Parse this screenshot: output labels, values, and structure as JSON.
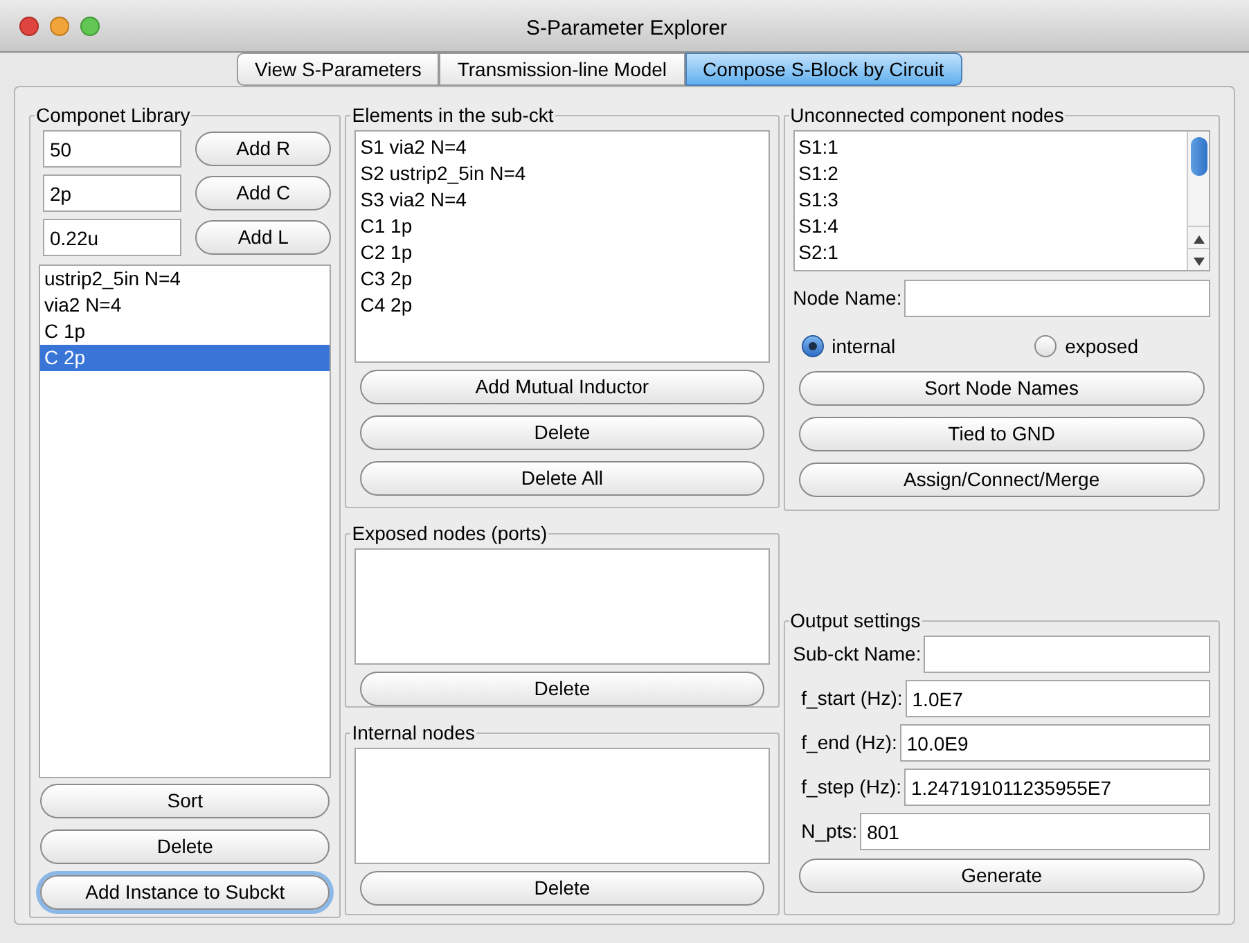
{
  "window": {
    "title": "S-Parameter Explorer"
  },
  "tabs": [
    {
      "label": "View S-Parameters",
      "selected": false
    },
    {
      "label": "Transmission-line Model",
      "selected": false
    },
    {
      "label": "Compose S-Block by Circuit",
      "selected": true
    }
  ],
  "library": {
    "title": "Componet Library",
    "inputs": [
      {
        "value": "50",
        "button": "Add R"
      },
      {
        "value": "2p",
        "button": "Add C"
      },
      {
        "value": "0.22u",
        "button": "Add L"
      }
    ],
    "items": [
      {
        "label": "ustrip2_5in N=4",
        "selected": false
      },
      {
        "label": "via2 N=4",
        "selected": false
      },
      {
        "label": "C 1p",
        "selected": false
      },
      {
        "label": "C 2p",
        "selected": true
      }
    ],
    "buttons": [
      {
        "label": "Sort",
        "focused": false
      },
      {
        "label": "Delete",
        "focused": false
      },
      {
        "label": "Add Instance to Subckt",
        "focused": true
      }
    ]
  },
  "elements": {
    "title": "Elements in the sub-ckt",
    "items": [
      "S1 via2 N=4",
      "S2 ustrip2_5in N=4",
      "S3 via2 N=4",
      "C1 1p",
      "C2 1p",
      "C3 2p",
      "C4 2p"
    ],
    "buttons": [
      "Add Mutual Inductor",
      "Delete",
      "Delete All"
    ]
  },
  "exposed": {
    "title": "Exposed nodes (ports)",
    "buttons": [
      "Delete"
    ]
  },
  "internal": {
    "title": "Internal nodes",
    "buttons": [
      "Delete"
    ]
  },
  "unconnected": {
    "title": "Unconnected component nodes",
    "items": [
      "S1:1",
      "S1:2",
      "S1:3",
      "S1:4",
      "S2:1"
    ],
    "node_name_label": "Node Name:",
    "radios": [
      {
        "label": "internal",
        "selected": true
      },
      {
        "label": "exposed",
        "selected": false
      }
    ],
    "buttons": [
      "Sort Node Names",
      "Tied to GND",
      "Assign/Connect/Merge"
    ]
  },
  "output": {
    "title": "Output settings",
    "fields": [
      {
        "label": "Sub-ckt Name:"
      },
      {
        "label": "f_start (Hz):",
        "value": "1.0E7"
      },
      {
        "label": "f_end (Hz):",
        "value": "10.0E9"
      },
      {
        "label": "f_step (Hz):",
        "value": "1.247191011235955E7"
      },
      {
        "label": "N_pts:",
        "value": "801"
      }
    ],
    "buttons": [
      "Generate"
    ]
  }
}
